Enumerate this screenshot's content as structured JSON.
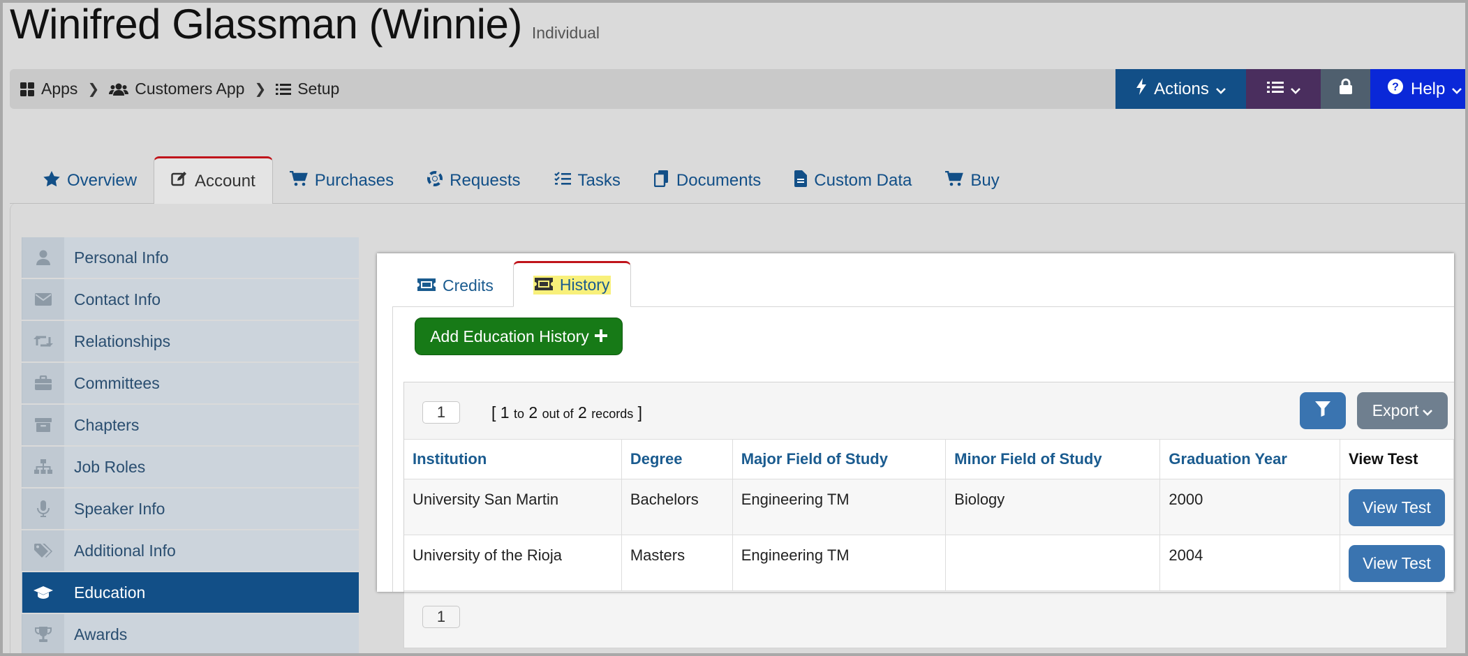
{
  "header": {
    "title": "Winifred Glassman (Winnie)",
    "subtitle": "Individual"
  },
  "breadcrumb": [
    {
      "label": "Apps",
      "icon": "grid-icon"
    },
    {
      "label": "Customers App",
      "icon": "users-icon"
    },
    {
      "label": "Setup",
      "icon": "list-icon"
    }
  ],
  "toolbar": {
    "actions_label": "Actions",
    "help_label": "Help",
    "colors": {
      "actions": "#124f87",
      "list": "#4a2e5e",
      "lock": "#4f5f6e",
      "help": "#0a28d8"
    }
  },
  "main_tabs": [
    {
      "label": "Overview",
      "icon": "star-icon"
    },
    {
      "label": "Account",
      "icon": "edit-icon",
      "active": true
    },
    {
      "label": "Purchases",
      "icon": "cart-icon"
    },
    {
      "label": "Requests",
      "icon": "lifebuoy-icon"
    },
    {
      "label": "Tasks",
      "icon": "tasks-icon"
    },
    {
      "label": "Documents",
      "icon": "documents-icon"
    },
    {
      "label": "Custom Data",
      "icon": "file-icon"
    },
    {
      "label": "Buy",
      "icon": "cart-icon"
    }
  ],
  "sidebar": [
    {
      "label": "Personal Info",
      "icon": "person-icon"
    },
    {
      "label": "Contact Info",
      "icon": "envelope-icon"
    },
    {
      "label": "Relationships",
      "icon": "retweet-icon"
    },
    {
      "label": "Committees",
      "icon": "briefcase-icon"
    },
    {
      "label": "Chapters",
      "icon": "archive-icon"
    },
    {
      "label": "Job Roles",
      "icon": "sitemap-icon"
    },
    {
      "label": "Speaker Info",
      "icon": "microphone-icon"
    },
    {
      "label": "Additional Info",
      "icon": "tags-icon"
    },
    {
      "label": "Education",
      "icon": "graduation-cap-icon",
      "active": true
    },
    {
      "label": "Awards",
      "icon": "trophy-icon"
    }
  ],
  "sub_tabs": {
    "credits": "Credits",
    "history": "History"
  },
  "add_button": "Add Education History",
  "grid": {
    "page": "1",
    "records": {
      "open": "[",
      "from": "1",
      "to_word": "to",
      "to": "2",
      "out_of": "out of",
      "total": "2",
      "records_word": "records",
      "close": "]"
    },
    "export_label": "Export",
    "columns": [
      "Institution",
      "Degree",
      "Major Field of Study",
      "Minor Field of Study",
      "Graduation Year",
      "View Test"
    ],
    "rows": [
      {
        "institution": "University San Martin",
        "degree": "Bachelors",
        "major": "Engineering TM",
        "minor": "Biology",
        "year": "2000",
        "action": "View Test"
      },
      {
        "institution": "University of the Rioja",
        "degree": "Masters",
        "major": "Engineering TM",
        "minor": "",
        "year": "2004",
        "action": "View Test"
      }
    ],
    "bottom_page": "1"
  }
}
